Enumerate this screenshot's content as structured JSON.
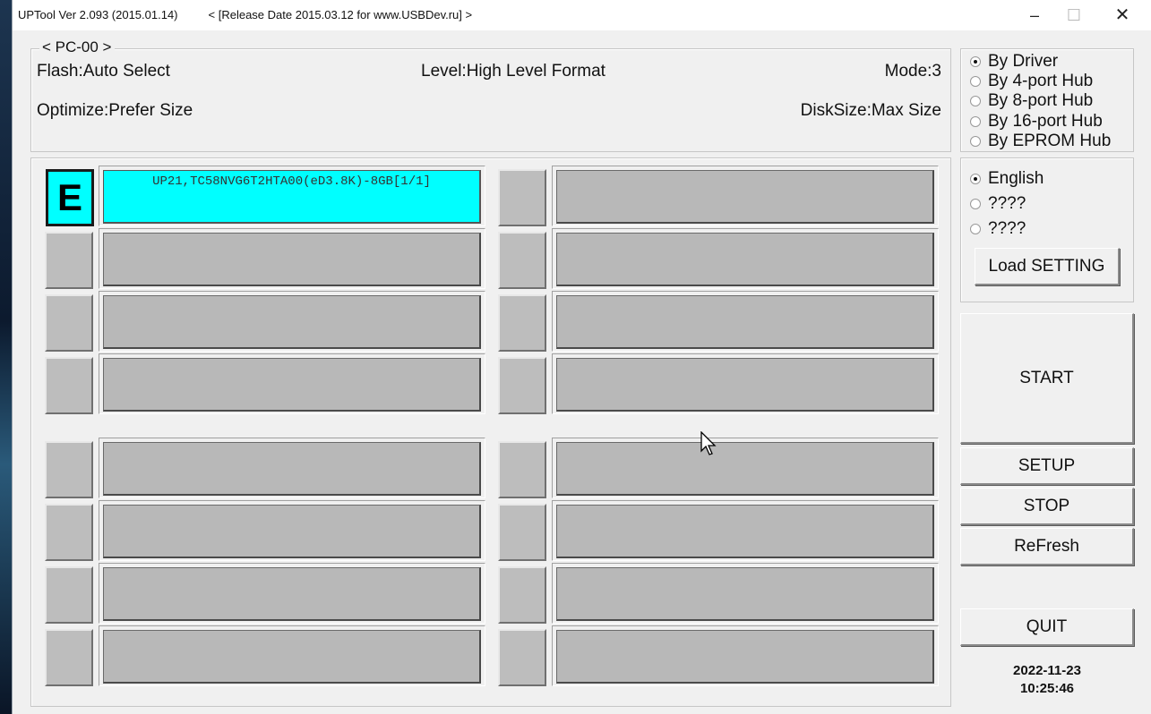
{
  "window": {
    "title": "UPTool Ver 2.093 (2015.01.14)",
    "title_release": "< [Release Date 2015.03.12 for www.USBDev.ru] >",
    "min_label": "–",
    "max_label": "☐",
    "close_label": "✕"
  },
  "info": {
    "legend": "< PC-00 >",
    "flash": "Flash:Auto Select",
    "level": "Level:High Level Format",
    "mode": "Mode:3",
    "optimize": "Optimize:Prefer Size",
    "disksize": "DiskSize:Max Size"
  },
  "ports": {
    "active_label": "E",
    "active_text": "UP21,TC58NVG6T2HTA00(eD3.8K)-8GB[1/1]",
    "active_color": "#00ffff",
    "idle_color": "#b8b8b8"
  },
  "hub_mode": {
    "options": [
      "By Driver",
      "By 4-port Hub",
      "By 8-port Hub",
      "By 16-port Hub",
      "By EPROM Hub"
    ],
    "selected": "By Driver"
  },
  "language": {
    "options": [
      "English",
      "????",
      "????"
    ],
    "selected": "English",
    "load_setting_label": "Load SETTING"
  },
  "buttons": {
    "start": "START",
    "setup": "SETUP",
    "stop": "STOP",
    "refresh": "ReFresh",
    "quit": "QUIT"
  },
  "clock": {
    "date": "2022-11-23",
    "time": "10:25:46"
  }
}
